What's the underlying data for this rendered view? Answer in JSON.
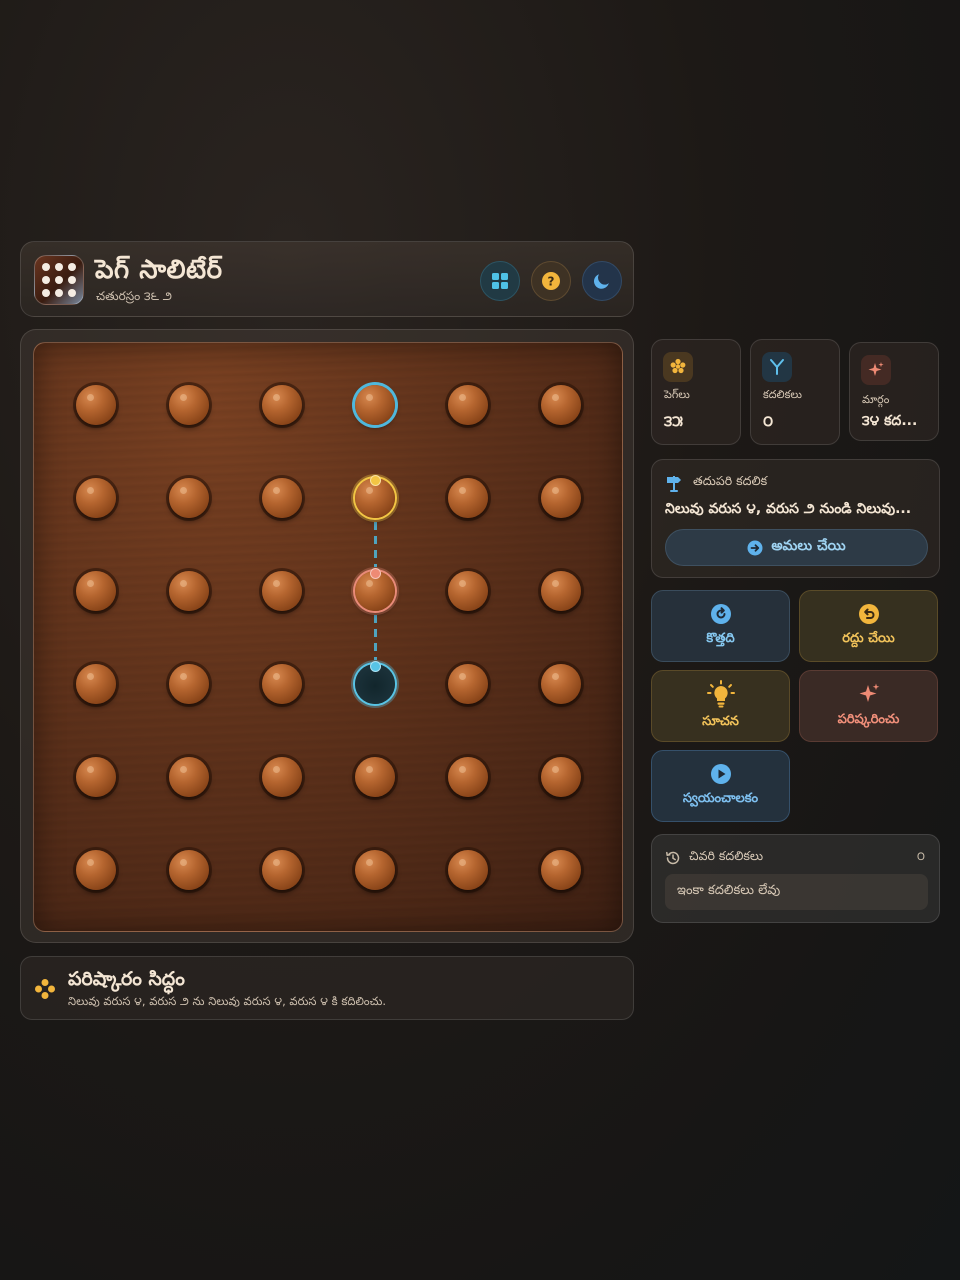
{
  "header": {
    "title": "పెగ్ సాలిటేర్",
    "subtitle": "చతురస్రం ౩౬ ౨",
    "buttons": [
      "grid-icon",
      "help-icon",
      "moon-icon"
    ]
  },
  "colors": {
    "accent_blue": "#58c4e6",
    "accent_yellow": "#f2c544",
    "accent_red": "#ee8a74",
    "board_wood": "#5f321b"
  },
  "board": {
    "rows": 6,
    "cols": 6,
    "empty": [
      [
        3,
        3
      ]
    ],
    "highlight_target": [
      0,
      3
    ],
    "move_from": [
      1,
      3
    ],
    "move_over": [
      2,
      3
    ],
    "move_to": [
      3,
      3
    ]
  },
  "status": {
    "title": "పరిష్కారం సిద్ధం",
    "text": "నిలువు వరుస ౪, వరుస ౨ ను నిలువు వరుస ౪, వరుస ౪ కి కదిలించు."
  },
  "stats": [
    {
      "label": "పెగ్‌లు",
      "value": "౩౫",
      "icon": "pegs-icon"
    },
    {
      "label": "కదలికలు",
      "value": "౦",
      "icon": "moves-icon"
    },
    {
      "label": "మార్గం",
      "value": "౩౪ కద...",
      "icon": "sparkle-icon"
    }
  ],
  "next_move": {
    "heading": "తదుపరి కదలిక",
    "text": "నిలువు వరుస ౪, వరుస ౨ నుండి నిలువు...",
    "apply_label": "అమలు చేయి"
  },
  "actions": {
    "new": "కొత్తది",
    "undo": "రద్దు చేయి",
    "hint": "సూచన",
    "solve": "పరిష్కరించు",
    "auto": "స్వయంచాలకం"
  },
  "recent": {
    "heading": "చివరి కదలికలు",
    "count": "౦",
    "empty_text": "ఇంకా కదలికలు లేవు"
  }
}
